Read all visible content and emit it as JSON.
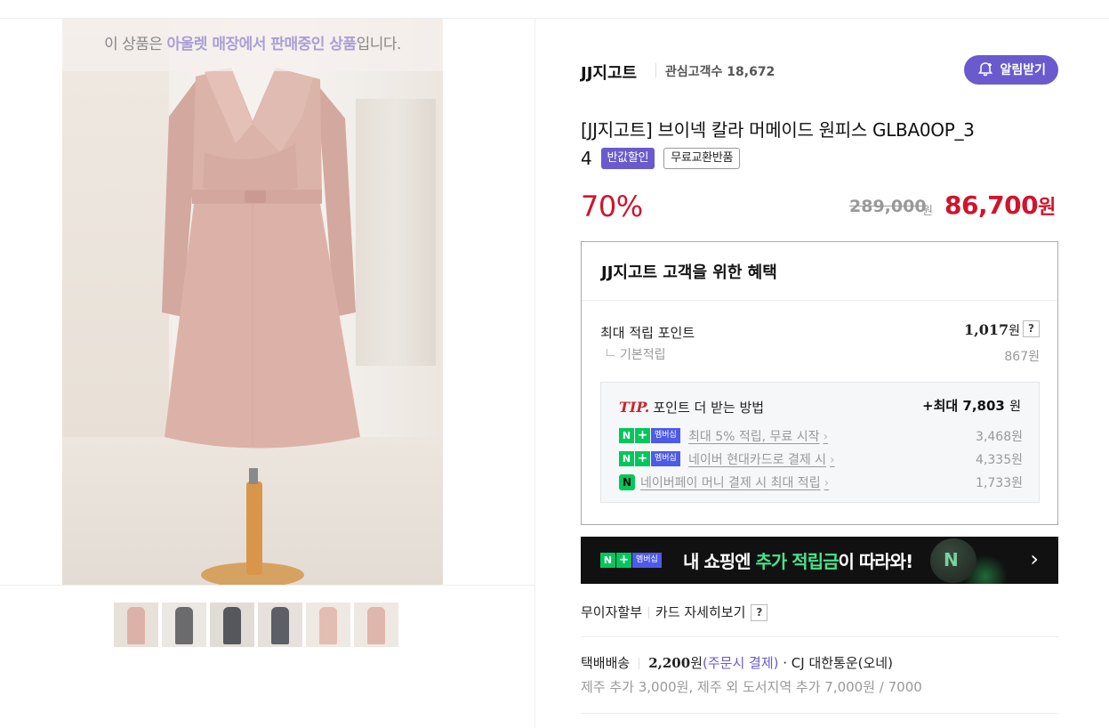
{
  "notice": {
    "pre": "이 상품은 ",
    "highlight1": "아울렛 매장에서 판매중인 상품",
    "post": "입니다."
  },
  "thumbnails": [
    {
      "bg": "#e8e1da",
      "fig": "#dcb2a8"
    },
    {
      "bg": "#ebe7e3",
      "fig": "#6b6b6e"
    },
    {
      "bg": "#e2dcd6",
      "fig": "#55575c"
    },
    {
      "bg": "#e6e1dc",
      "fig": "#5c5f65"
    },
    {
      "bg": "#efe9e4",
      "fig": "#e3bcb2"
    },
    {
      "bg": "#efe8e2",
      "fig": "#dfb6ac"
    }
  ],
  "store": {
    "brand": "JJ지고트",
    "fav_label": "관심고객수 18,672",
    "alarm_label": "알림받기"
  },
  "product": {
    "title": "[JJ지고트] 브이넥 칼라 머메이드 원피스 GLBA0OP_3",
    "title_tail": "4",
    "badge1": "반값할인",
    "badge2": "무료교환반품",
    "discount": "70%",
    "original_price": "289,000",
    "original_won": "원",
    "price": "86,700",
    "price_won": "원"
  },
  "benefit": {
    "heading": "JJ지고트 고객을 위한 혜택",
    "max_points_label": "최대 적립 포인트",
    "max_points_value": "1,017",
    "won": "원",
    "help": "?",
    "base_label": "기본적립",
    "base_value": "867원",
    "tip_word": "TIP.",
    "tip_heading": "포인트 더 받는 방법",
    "tip_max": "+최대 7,803",
    "tip_won": "원",
    "rows": [
      {
        "text": "최대 5% 적립, 무료 시작",
        "amount": "3,468원"
      },
      {
        "text": "네이버 현대카드로 결제 시",
        "amount": "4,335원"
      },
      {
        "text": "네이버페이 머니 결제 시 최대 적립",
        "amount": "1,733원"
      }
    ],
    "arrow": "›"
  },
  "badges": {
    "n": "N",
    "plus": "+",
    "membership": "멤버십",
    "npay": "N"
  },
  "banner": {
    "pre": "내 쇼핑엔 ",
    "green": "추가 적립금",
    "post": "이 따라와!",
    "coin": "N",
    "chevron": "›"
  },
  "install": {
    "label1": "무이자할부",
    "label2": "카드 자세히보기",
    "help": "?"
  },
  "shipping": {
    "label": "택배배송",
    "fee": "2,200",
    "won": "원",
    "pay": "(주문시 결제)",
    "carrier": " · CJ 대한통운(오네)",
    "extra": "제주 추가 3,000원, 제주 외 도서지역 추가 7,000원 / 7000"
  },
  "colors": {
    "accent": "#6a5acd",
    "sale_red": "#d0142d",
    "naver_green": "#03c75a",
    "membership_blue": "#4e5ae8"
  }
}
